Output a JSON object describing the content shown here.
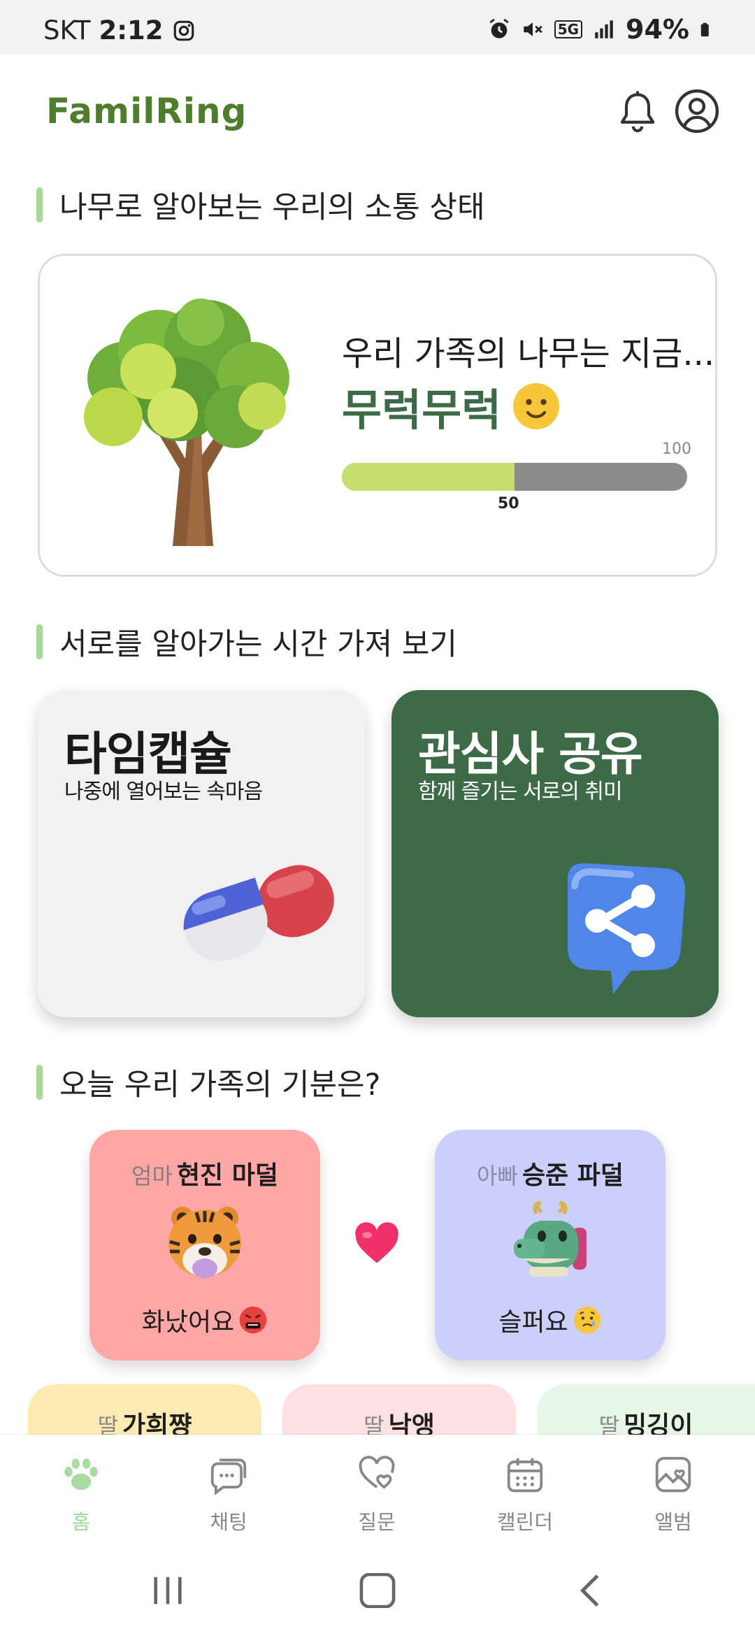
{
  "status_bar": {
    "carrier": "SKT",
    "time": "2:12",
    "network": "5G",
    "battery": "94%",
    "icons": [
      "instagram-icon",
      "alarm-icon",
      "mute-icon",
      "5g-icon",
      "signal-icon",
      "battery-icon"
    ]
  },
  "header": {
    "logo": "FamilRing",
    "logo_color": "#4e7d2c",
    "icons": [
      "bell-icon",
      "profile-icon"
    ]
  },
  "tree_section": {
    "title": "나무로 알아보는 우리의 소통 상태",
    "line1": "우리 가족의 나무는 지금...",
    "status": "무럭무럭",
    "status_color": "#3e6b47",
    "progress_value": 50,
    "progress_max": 100,
    "progress_value_label": "50",
    "progress_max_label": "100"
  },
  "time_section": {
    "title": "서로를 알아가는 시간 가져 보기",
    "cards": [
      {
        "title": "타임캡슐",
        "subtitle": "나중에 열어보는 속마음",
        "icon": "capsule-pill-icon",
        "bg": "#f1f1f1"
      },
      {
        "title": "관심사 공유",
        "subtitle": "함께 즐기는 서로의 취미",
        "icon": "share-bubble-icon",
        "bg": "#3e6b47"
      }
    ]
  },
  "mood_section": {
    "title": "오늘 우리 가족의 기분은?",
    "members": [
      {
        "role": "엄마",
        "name": "현진 마덜",
        "mood": "화났어요",
        "avatar": "tiger-icon",
        "mood_icon": "angry-face-icon",
        "bg": "#ffa6a6"
      },
      {
        "role": "아빠",
        "name": "승준 파덜",
        "mood": "슬퍼요",
        "avatar": "dragon-icon",
        "mood_icon": "sad-face-icon",
        "bg": "#cbcffc"
      }
    ],
    "more_members": [
      {
        "role": "딸",
        "name": "가희쨩",
        "bg": "#fdebb3"
      },
      {
        "role": "딸",
        "name": "낙앵",
        "bg": "#fde0e2"
      },
      {
        "role": "딸",
        "name": "밍깅이",
        "bg": "#e6f7e6"
      }
    ]
  },
  "bottom_nav": {
    "active_color": "#9fd89a",
    "items": [
      {
        "label": "홈",
        "icon": "paw-icon",
        "active": true
      },
      {
        "label": "채팅",
        "icon": "chat-icon",
        "active": false
      },
      {
        "label": "질문",
        "icon": "heart-chat-icon",
        "active": false
      },
      {
        "label": "캘린더",
        "icon": "calendar-icon",
        "active": false
      },
      {
        "label": "앨범",
        "icon": "album-icon",
        "active": false
      }
    ]
  },
  "system_nav": {
    "icons": [
      "recents-icon",
      "home-icon",
      "back-icon"
    ]
  }
}
